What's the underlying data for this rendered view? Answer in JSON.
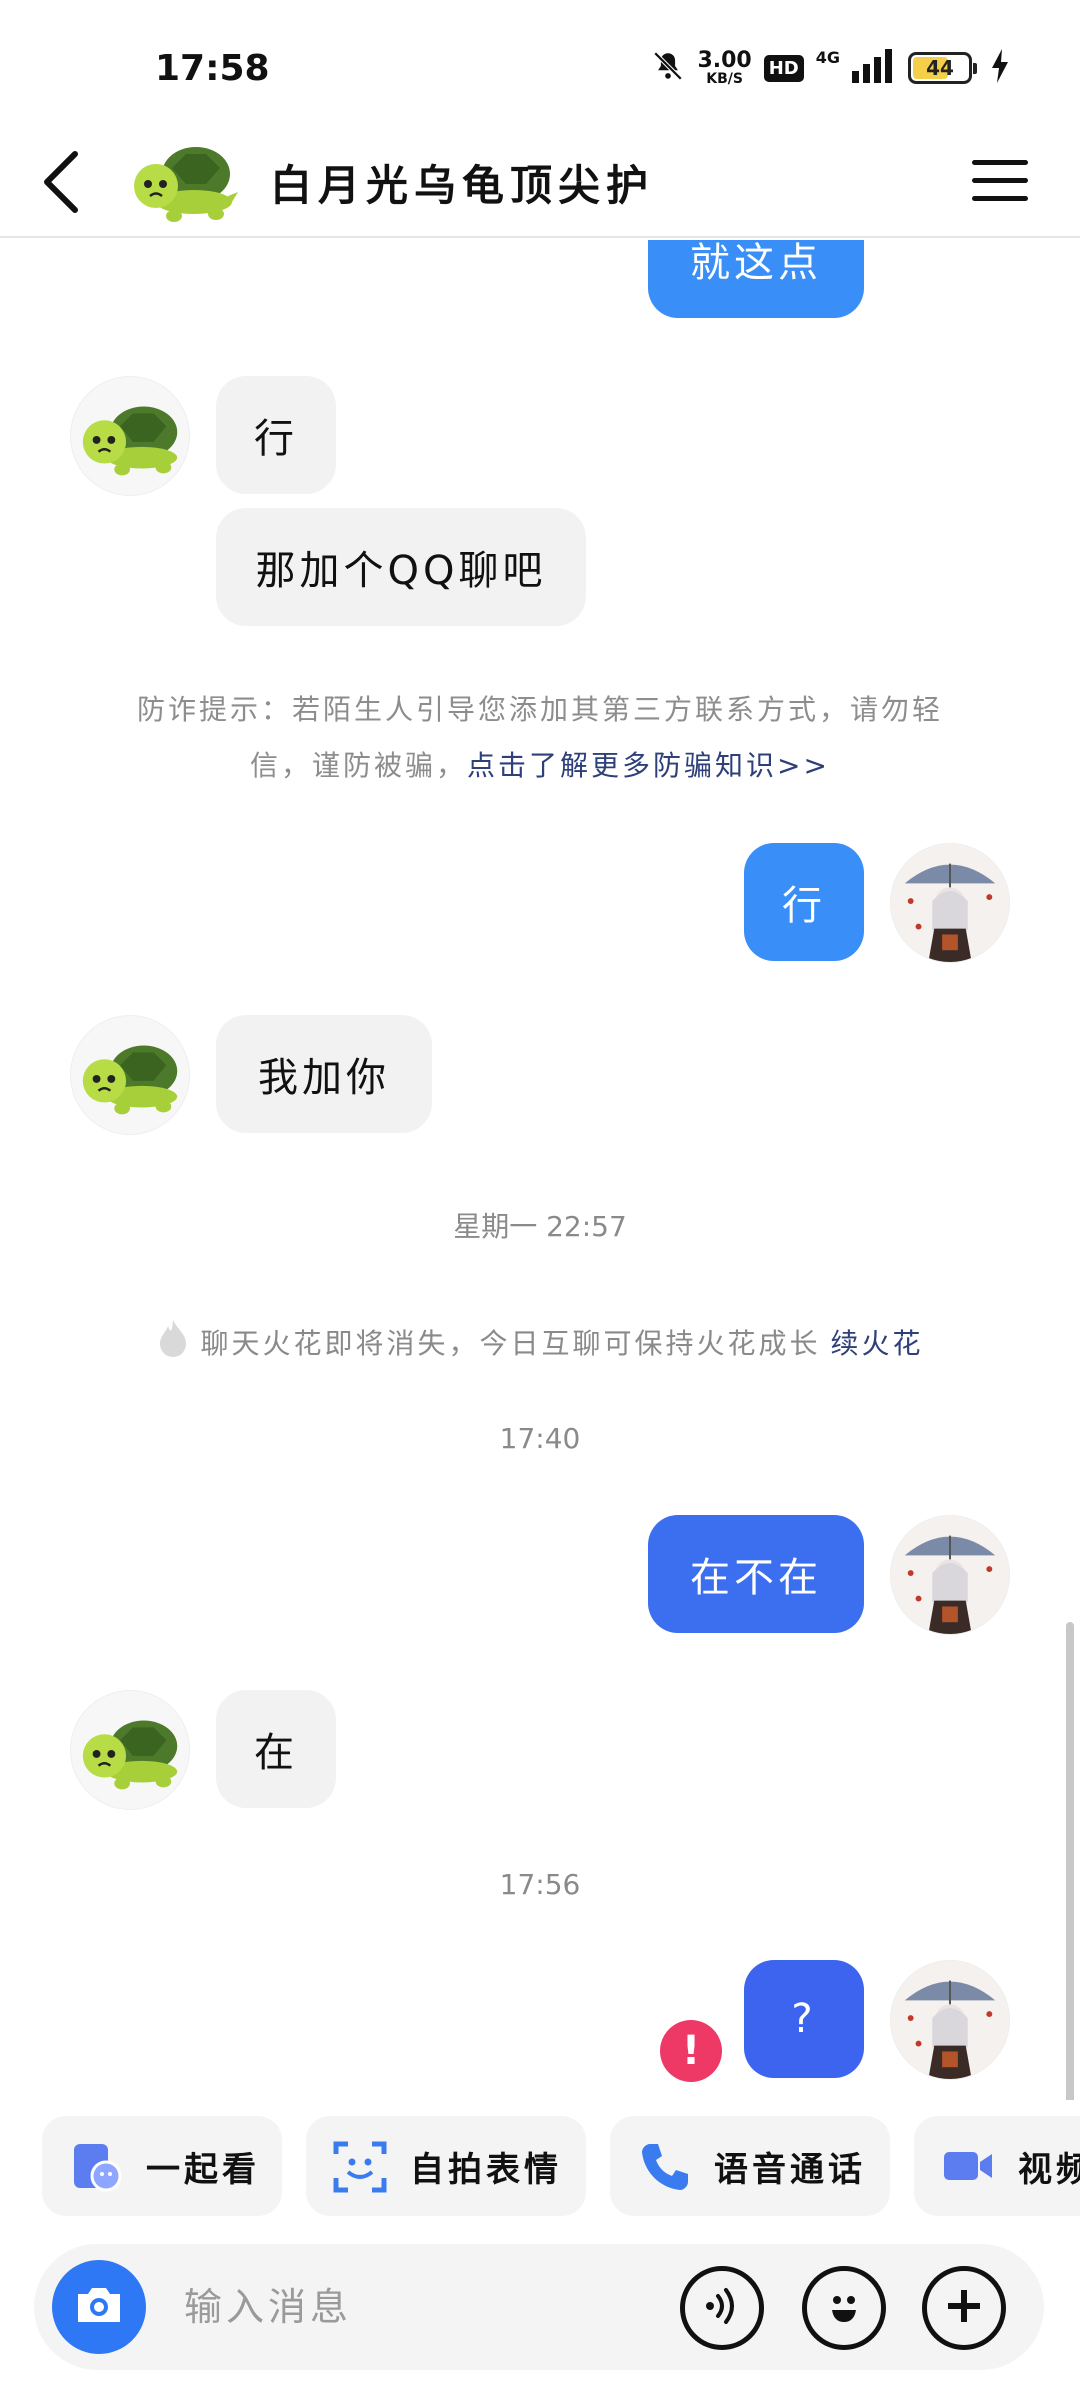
{
  "status_bar": {
    "time": "17:58",
    "net_speed_value": "3.00",
    "net_speed_unit": "KB/S",
    "hd_badge": "HD",
    "network_type": "4G",
    "battery_level": "44"
  },
  "header": {
    "title": "白月光乌龟顶尖护",
    "back_icon": "chevron-left-icon",
    "menu_icon": "hamburger-menu-icon"
  },
  "chat": {
    "messages": [
      {
        "side": "out",
        "text": "就这点",
        "color": "#3a8ef7"
      },
      {
        "side": "in",
        "text": "行"
      },
      {
        "side": "in",
        "text": "那加个QQ聊吧"
      },
      {
        "side": "out",
        "text": "行",
        "color": "#3a8ef7"
      },
      {
        "side": "in",
        "text": "我加你"
      },
      {
        "side": "out",
        "text": "在不在",
        "color": "#3b6ff0"
      },
      {
        "side": "in",
        "text": "在"
      },
      {
        "side": "out",
        "text": "?",
        "color": "#3d64ee",
        "failed": true
      }
    ],
    "fraud_notice": {
      "line1": "防诈提示：若陌生人引导您添加其第三方联系方式，请勿轻",
      "line2_prefix": "信，谨防被骗，",
      "link": "点击了解更多防骗知识>>"
    },
    "timestamps": [
      "星期一 22:57",
      "17:40",
      "17:56"
    ],
    "spark_notice": {
      "text": "聊天火花即将消失，今日互聊可保持火花成长",
      "link": "续火花"
    },
    "error_mark": "!"
  },
  "quick_actions": [
    {
      "label": "一起看",
      "icon": "watch-together-icon"
    },
    {
      "label": "自拍表情",
      "icon": "selfie-sticker-icon"
    },
    {
      "label": "语音通话",
      "icon": "phone-icon"
    },
    {
      "label": "视频",
      "icon": "video-camera-icon"
    }
  ],
  "input_bar": {
    "placeholder": "输入消息",
    "camera_icon": "camera-icon",
    "voice_icon": "voice-icon",
    "emoji_icon": "emoji-icon",
    "add_icon": "plus-icon"
  },
  "colors": {
    "accent": "#2e78f5",
    "bubble_in": "#f2f2f2",
    "link": "#2e3f7a",
    "error": "#ee3966"
  }
}
